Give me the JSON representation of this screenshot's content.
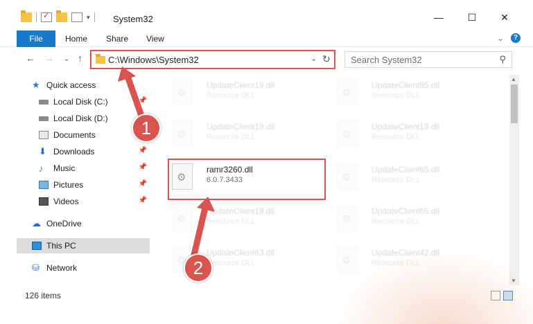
{
  "window": {
    "title": "System32",
    "minimize": "—",
    "maximize": "☐",
    "close": "✕"
  },
  "ribbon": {
    "tabs": [
      "File",
      "Home",
      "Share",
      "View"
    ],
    "expand": "⌄",
    "help": "?"
  },
  "address": {
    "back": "←",
    "forward": "→",
    "recent": "⌄",
    "up": "↑",
    "path": "C:\\Windows\\System32",
    "chevron": "⌄",
    "refresh": "↻"
  },
  "search": {
    "placeholder": "Search System32",
    "icon": "⚲"
  },
  "nav": {
    "items": [
      {
        "label": "Quick access",
        "icon": "star-icon"
      },
      {
        "label": "Local Disk (C:)",
        "icon": "drive-icon"
      },
      {
        "label": "Local Disk (D:)",
        "icon": "drive-icon"
      },
      {
        "label": "Documents",
        "icon": "documents-icon"
      },
      {
        "label": "Downloads",
        "icon": "download-icon"
      },
      {
        "label": "Music",
        "icon": "music-icon"
      },
      {
        "label": "Pictures",
        "icon": "pictures-icon"
      },
      {
        "label": "Videos",
        "icon": "videos-icon"
      },
      {
        "label": "OneDrive",
        "icon": "cloud-icon"
      },
      {
        "label": "This PC",
        "icon": "computer-icon",
        "selected": true
      },
      {
        "label": "Network",
        "icon": "network-icon"
      }
    ],
    "pin": "📌"
  },
  "files": [
    {
      "name": "UpdateClient19.dll",
      "desc": "Resource DLL"
    },
    {
      "name": "UpdateClient65.dll",
      "desc": "Resource DLL"
    },
    {
      "name": "UpdateClient19.dll",
      "desc": "Resource DLL"
    },
    {
      "name": "UpdateClient19.dll",
      "desc": "Resource DLL"
    },
    {
      "name": "ramr3260.dll",
      "desc": "6.0.7.3433"
    },
    {
      "name": "UpdateClient65.dll",
      "desc": "Resource DLL"
    },
    {
      "name": "UpdateClient19.dll",
      "desc": "Resource DLL"
    },
    {
      "name": "UpdateClient65.dll",
      "desc": "Resource DLL"
    },
    {
      "name": "UpdateClient63.dll",
      "desc": "Resource DLL"
    },
    {
      "name": "UpdateClient42.dll",
      "desc": "Resource DLL"
    }
  ],
  "status": {
    "count": "126 items"
  },
  "annotations": {
    "step1": "1",
    "step2": "2",
    "color": "#d9534f"
  }
}
